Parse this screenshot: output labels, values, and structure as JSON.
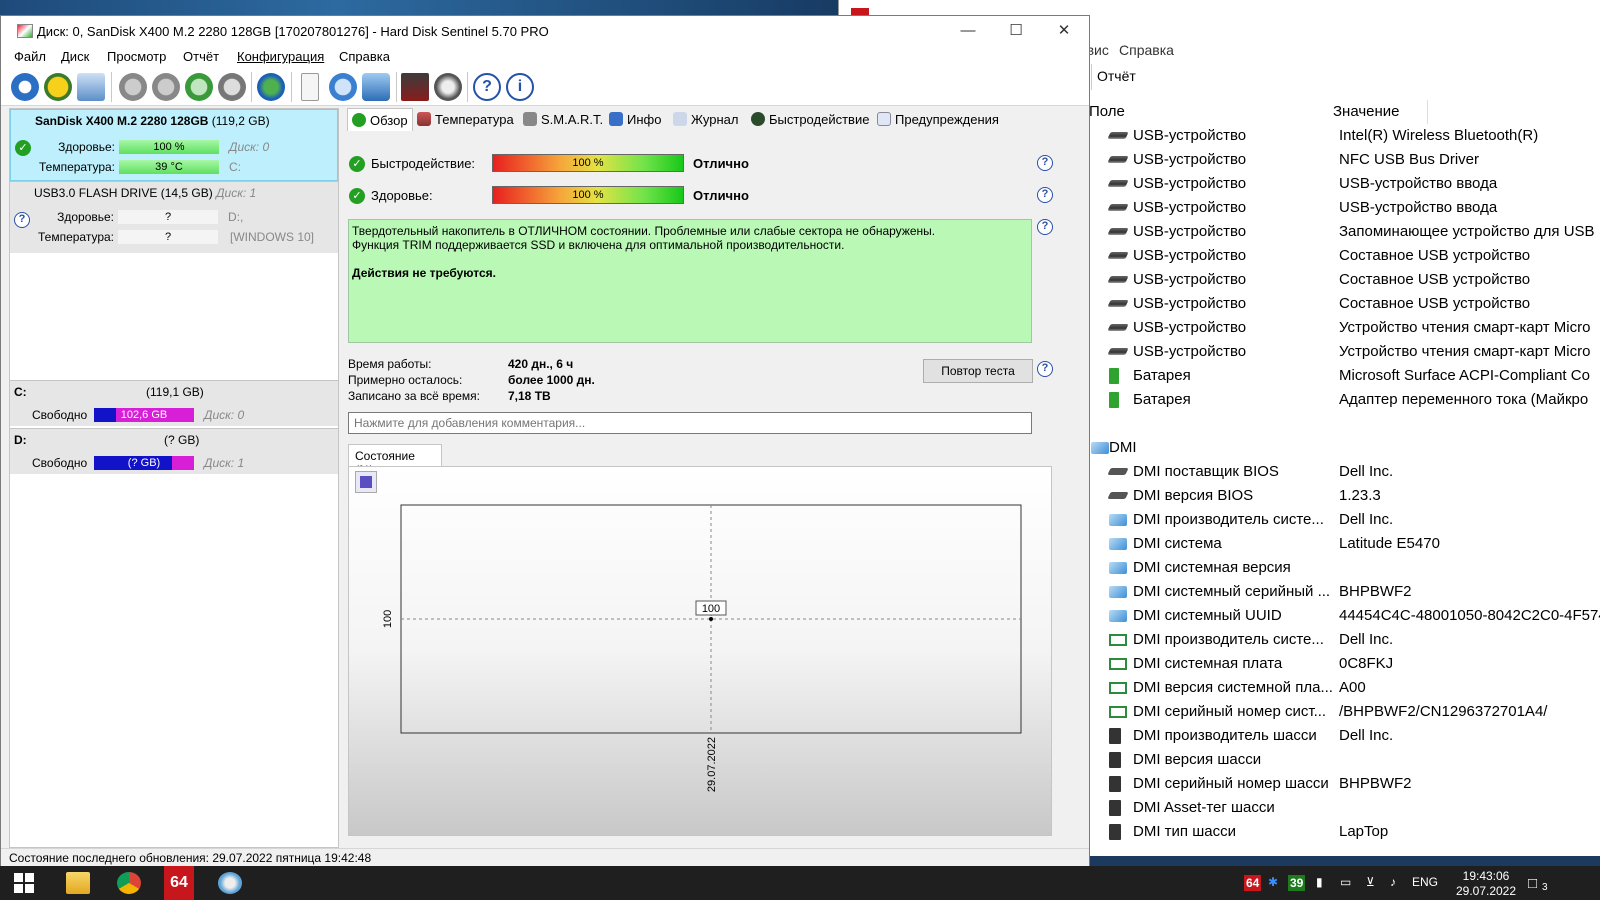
{
  "aida": {
    "menu": [
      "ервис",
      "Справка"
    ],
    "report_label": "Отчёт",
    "col_field": "Поле",
    "col_value": "Значение",
    "rows": [
      {
        "field": "USB-устройство",
        "value": "Intel(R) Wireless Bluetooth(R)",
        "icon": "usb"
      },
      {
        "field": "USB-устройство",
        "value": "NFC USB Bus Driver",
        "icon": "usb"
      },
      {
        "field": "USB-устройство",
        "value": "USB-устройство ввода",
        "icon": "usb"
      },
      {
        "field": "USB-устройство",
        "value": "USB-устройство ввода",
        "icon": "usb"
      },
      {
        "field": "USB-устройство",
        "value": "Запоминающее устройство для USB",
        "icon": "usb"
      },
      {
        "field": "USB-устройство",
        "value": "Составное USB устройство",
        "icon": "usb"
      },
      {
        "field": "USB-устройство",
        "value": "Составное USB устройство",
        "icon": "usb"
      },
      {
        "field": "USB-устройство",
        "value": "Составное USB устройство",
        "icon": "usb"
      },
      {
        "field": "USB-устройство",
        "value": "Устройство чтения смарт-карт Micro",
        "icon": "usb"
      },
      {
        "field": "USB-устройство",
        "value": "Устройство чтения смарт-карт Micro",
        "icon": "usb"
      },
      {
        "field": "Батарея",
        "value": "Microsoft Surface ACPI-Compliant Co",
        "icon": "bat"
      },
      {
        "field": "Батарея",
        "value": "Адаптер переменного тока (Майкро",
        "icon": "bat"
      },
      {
        "field": "",
        "value": "",
        "icon": ""
      },
      {
        "field": "DMI",
        "value": "",
        "icon": "pc",
        "group": true
      },
      {
        "field": "DMI поставщик BIOS",
        "value": "Dell Inc.",
        "icon": "bios"
      },
      {
        "field": "DMI версия BIOS",
        "value": "1.23.3",
        "icon": "bios"
      },
      {
        "field": "DMI производитель систе...",
        "value": "Dell Inc.",
        "icon": "pc"
      },
      {
        "field": "DMI система",
        "value": "Latitude E5470",
        "icon": "pc"
      },
      {
        "field": "DMI системная версия",
        "value": "",
        "icon": "pc"
      },
      {
        "field": "DMI системный серийный ...",
        "value": "BHPBWF2",
        "icon": "pc"
      },
      {
        "field": "DMI системный UUID",
        "value": "44454C4C-48001050-8042C2C0-4F574",
        "icon": "pc"
      },
      {
        "field": "DMI производитель систе...",
        "value": "Dell Inc.",
        "icon": "board"
      },
      {
        "field": "DMI системная плата",
        "value": "0C8FKJ",
        "icon": "board"
      },
      {
        "field": "DMI версия системной пла...",
        "value": "A00",
        "icon": "board"
      },
      {
        "field": "DMI серийный номер сист...",
        "value": "/BHPBWF2/CN1296372701A4/",
        "icon": "board"
      },
      {
        "field": "DMI производитель шасси",
        "value": "Dell Inc.",
        "icon": "chassis"
      },
      {
        "field": "DMI версия шасси",
        "value": "",
        "icon": "chassis"
      },
      {
        "field": "DMI серийный номер шасси",
        "value": "BHPBWF2",
        "icon": "chassis"
      },
      {
        "field": "DMI Asset-тег шасси",
        "value": "",
        "icon": "chassis"
      },
      {
        "field": "DMI тип шасси",
        "value": "LapTop",
        "icon": "chassis"
      }
    ]
  },
  "hds": {
    "title": "Диск: 0, SanDisk X400 M.2 2280 128GB [170207801276]  -  Hard Disk Sentinel 5.70 PRO",
    "menu": [
      "Файл",
      "Диск",
      "Просмотр",
      "Отчёт",
      "Конфигурация",
      "Справка"
    ],
    "disks": [
      {
        "name": "SanDisk X400 M.2 2280 128GB",
        "size": "(119,2 GB)",
        "health_label": "Здоровье:",
        "health": "100 %",
        "temp_label": "Температура:",
        "temp": "39 °C",
        "disk_no": "Диск: 0",
        "drive": "C:"
      },
      {
        "name": "USB3.0  FLASH DRIVE",
        "size": "(14,5 GB)",
        "disk_no": "Диск: 1",
        "health_label": "Здоровье:",
        "health": "?",
        "temp_label": "Температура:",
        "temp": "?",
        "drive": "D:,",
        "os": "[WINDOWS 10]"
      }
    ],
    "volumes": [
      {
        "letter": "C:",
        "size": "(119,1 GB)",
        "free_label": "Свободно",
        "free": "102,6 GB",
        "disk": "Диск: 0"
      },
      {
        "letter": "D:",
        "size": "(? GB)",
        "free_label": "Свободно",
        "free": "(? GB)",
        "disk": "Диск: 1"
      }
    ],
    "tabs": [
      "Обзор",
      "Температура",
      "S.M.A.R.T.",
      "Инфо",
      "Журнал",
      "Быстродействие",
      "Предупреждения"
    ],
    "perf_label": "Быстродействие:",
    "perf_value": "100 %",
    "perf_text": "Отлично",
    "health_label": "Здоровье:",
    "health_value": "100 %",
    "health_text": "Отлично",
    "message_line1": "Твердотельный накопитель в ОТЛИЧНОМ состоянии. Проблемные или слабые сектора не обнаружены.",
    "message_line2": "Функция TRIM поддерживается SSD и включена для оптимальной производительности.",
    "message_bold": "Действия не требуются.",
    "uptime_label": "Время работы:",
    "uptime_value": "420 дн., 6 ч",
    "remaining_label": "Примерно осталось:",
    "remaining_value": "более 1000 дн.",
    "written_label": "Записано за всё время:",
    "written_value": "7,18 TB",
    "retest_button": "Повтор теста",
    "comment_placeholder": "Нажмите для добавления комментария...",
    "state_tab": "Состояние (%)",
    "status_bar": "Состояние последнего обновления: 29.07.2022 пятница 19:42:48"
  },
  "chart_data": {
    "type": "line",
    "title": "",
    "x": [
      "29.07.2022"
    ],
    "series": [
      {
        "values": [
          100
        ]
      }
    ],
    "ylabel": "",
    "xlabel": "",
    "y_tick": "100",
    "x_tick": "29.07.2022",
    "point_label": "100"
  },
  "taskbar": {
    "tray_badge": "64",
    "tray_temp": "39",
    "lang": "ENG",
    "time": "19:43:06",
    "date": "29.07.2022",
    "notif_count": "3",
    "app_badge": "64"
  }
}
